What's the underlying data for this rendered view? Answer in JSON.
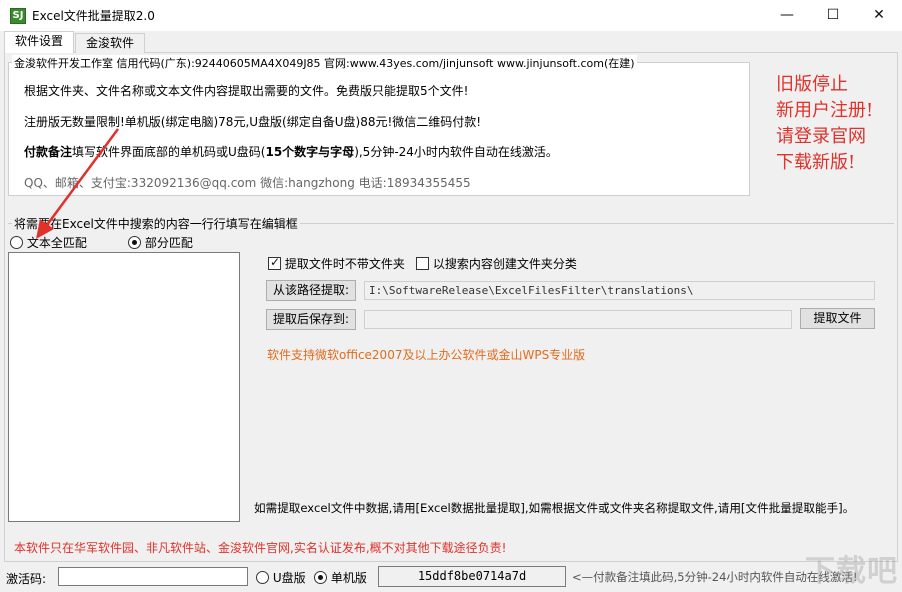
{
  "window": {
    "title": "Excel文件批量提取2.0",
    "icon_glyph": "SJ",
    "controls": {
      "minimize": "—",
      "maximize": "☐",
      "close": "✕"
    }
  },
  "tabs": [
    {
      "label": "软件设置",
      "active": true
    },
    {
      "label": "金浚软件",
      "active": false
    }
  ],
  "info": {
    "legend": "金浚软件开发工作室 信用代码(广东):92440605MA4X049J85 官网:www.43yes.com/jinjunsoft  www.jinjunsoft.com(在建)",
    "line1": "根据文件夹、文件名称或文本文件内容提取出需要的文件。免费版只能提取5个文件!",
    "line2": "注册版无数量限制!单机版(绑定电脑)78元,U盘版(绑定自备U盘)88元!微信二维码付款!",
    "line3_bold": "付款备注",
    "line3_rest": "填写软件界面底部的单机码或U盘码(",
    "line3_bold2": "15个数字与字母",
    "line3_end": "),5分钟-24小时内软件自动在线激活。",
    "line4": "QQ、邮箱、支付宝:332092136@qq.com   微信:hangzhong   电话:18934355455"
  },
  "notice": {
    "lines": [
      "旧版停止",
      "新用户注册!",
      "请登录官网",
      "下载新版!"
    ],
    "color": "#e0312b"
  },
  "search": {
    "legend": "将需要在Excel文件中搜索的内容一行行填写在编辑框",
    "radio_full": "文本全匹配",
    "radio_partial": "部分匹配",
    "selected": "partial",
    "edit_value": ""
  },
  "options": {
    "no_folder_label": "提取文件时不带文件夹",
    "no_folder_checked": true,
    "create_folder_label": "以搜索内容创建文件夹分类",
    "create_folder_checked": false
  },
  "paths": {
    "from_button": "从该路径提取:",
    "from_value": "I:\\SoftwareRelease\\ExcelFilesFilter\\translations\\",
    "save_button": "提取后保存到:",
    "save_value": "",
    "extract_button": "提取文件"
  },
  "support_note": "软件支持微软office2007及以上办公软件或金山WPS专业版",
  "hint": "如需提取excel文件中数据,请用[Excel数据批量提取],如需根据文件或文件夹名称提取文件,请用[文件批量提取能手]。",
  "footer": {
    "release_note": "本软件只在华军软件园、非凡软件站、金浚软件官网,实名认证发布,概不对其他下载途径负责!",
    "activation_label": "激活码:",
    "activation_value": "",
    "radio_usb": "U盘版",
    "radio_single": "单机版",
    "selected": "single",
    "machine_code": "15ddf8be0714a7d",
    "payment_hint": "<—付款备注填此码,5分钟-24小时内软件自动在线激活!"
  },
  "watermark": "下载吧"
}
